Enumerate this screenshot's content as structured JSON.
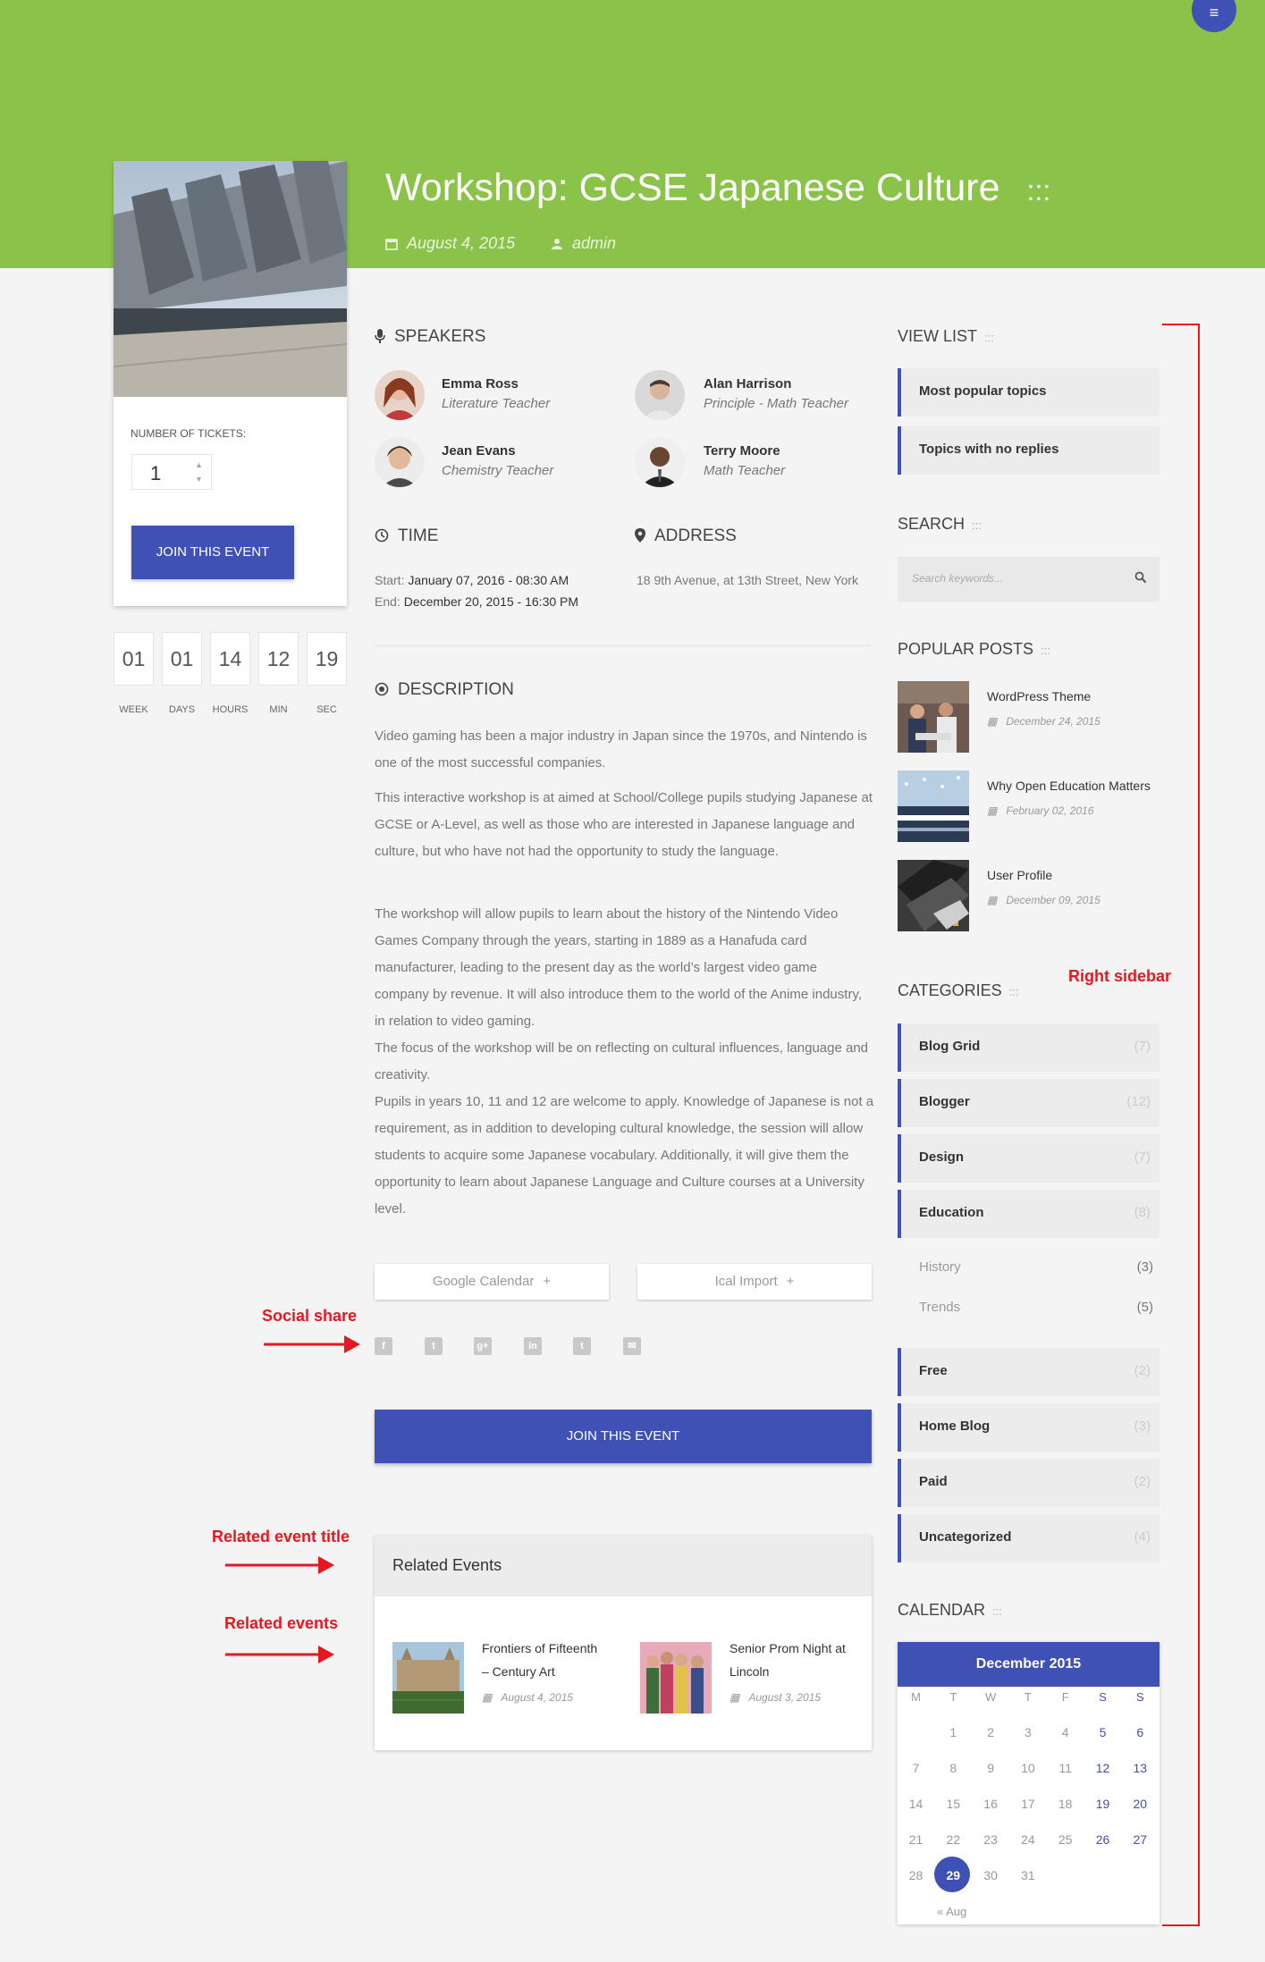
{
  "header": {
    "title": "Workshop: GCSE Japanese Culture",
    "title_dots": ":::",
    "date": "August 4, 2015",
    "author": "admin",
    "menu_icon": "≡"
  },
  "ticket": {
    "label": "NUMBER OF TICKETS:",
    "quantity": "1",
    "join_label": "JOIN THIS EVENT"
  },
  "countdown": [
    {
      "value": "01",
      "label": "WEEK"
    },
    {
      "value": "01",
      "label": "DAYS"
    },
    {
      "value": "14",
      "label": "HOURS"
    },
    {
      "value": "12",
      "label": "MIN"
    },
    {
      "value": "19",
      "label": "SEC"
    }
  ],
  "speakers": {
    "heading": "SPEAKERS",
    "items": [
      {
        "name": "Emma Ross",
        "role": "Literature Teacher"
      },
      {
        "name": "Alan Harrison",
        "role": "Principle - Math Teacher"
      },
      {
        "name": "Jean Evans",
        "role": "Chemistry Teacher"
      },
      {
        "name": "Terry Moore",
        "role": "Math Teacher"
      }
    ]
  },
  "time": {
    "heading": "TIME",
    "start_label": "Start:",
    "start": "January 07, 2016 - 08:30 AM",
    "end_label": "End:",
    "end": "December 20, 2015 - 16:30 PM"
  },
  "address": {
    "heading": "ADDRESS",
    "value": "18 9th Avenue, at 13th Street, New York"
  },
  "description": {
    "heading": "DESCRIPTION",
    "p1": "Video gaming has been a major industry in Japan since the 1970s, and Nintendo is one of the most successful companies.",
    "p2": "This interactive workshop is at aimed at School/College pupils studying Japanese at GCSE or A-Level, as well as those who are interested in Japanese language and culture, but who have not had the opportunity to study the language.",
    "p3": "The workshop will allow pupils to learn about the history of the Nintendo Video Games Company through the years, starting in 1889 as a Hanafuda card manufacturer, leading to the present day as the world’s largest video game company by revenue. It will also introduce them to the world of the Anime industry, in relation to video gaming.",
    "p4": "The focus of the workshop will be on reflecting on cultural influences, language and creativity.",
    "p5": "Pupils in years 10, 11 and 12 are welcome to apply. Knowledge of Japanese is not a requirement, as in addition to developing cultural knowledge, the session will allow students to acquire some Japanese vocabulary. Additionally, it will give them the opportunity to learn about Japanese Language and Culture courses at a University level."
  },
  "actions": {
    "google_calendar": "Google Calendar",
    "ical_import": "Ical Import",
    "join_label": "JOIN THIS EVENT"
  },
  "share_icons": [
    "facebook-icon",
    "twitter-icon",
    "google-plus-icon",
    "linkedin-icon",
    "tumblr-icon",
    "email-icon"
  ],
  "related": {
    "title": "Related Events",
    "items": [
      {
        "name": "Frontiers of Fifteenth – Century Art",
        "date": "August 4, 2015"
      },
      {
        "name": "Senior Prom Night at Lincoln",
        "date": "August 3, 2015"
      }
    ]
  },
  "annotations": {
    "social_share": "Social share",
    "related_title": "Related event title",
    "related_events": "Related events",
    "right_sidebar": "Right sidebar"
  },
  "sidebar": {
    "view_list": {
      "heading": "VIEW LIST",
      "items": [
        "Most popular topics",
        "Topics with no replies"
      ]
    },
    "search": {
      "heading": "SEARCH",
      "placeholder": "Search keywords..."
    },
    "popular_posts": {
      "heading": "POPULAR POSTS",
      "items": [
        {
          "title": "WordPress Theme",
          "date": "December 24, 2015"
        },
        {
          "title": "Why Open Education Matters",
          "date": "February 02, 2016"
        },
        {
          "title": "User Profile",
          "date": "December 09, 2015"
        }
      ]
    },
    "categories": {
      "heading": "CATEGORIES",
      "items": [
        {
          "name": "Blog Grid",
          "count": "(7)"
        },
        {
          "name": "Blogger",
          "count": "(12)"
        },
        {
          "name": "Design",
          "count": "(7)"
        },
        {
          "name": "Education",
          "count": "(8)"
        },
        {
          "name": "Free",
          "count": "(2)"
        },
        {
          "name": "Home Blog",
          "count": "(3)"
        },
        {
          "name": "Paid",
          "count": "(2)"
        },
        {
          "name": "Uncategorized",
          "count": "(4)"
        }
      ],
      "sub_items": [
        {
          "name": "History",
          "count": "(3)"
        },
        {
          "name": "Trends",
          "count": "(5)"
        }
      ]
    },
    "calendar": {
      "heading": "CALENDAR",
      "month": "December 2015",
      "weekdays": [
        "M",
        "T",
        "W",
        "T",
        "F",
        "S",
        "S"
      ],
      "today": "29",
      "prev_link": "« Aug"
    }
  },
  "heading_dots": ":::",
  "colors": {
    "hero": "#8bc34a",
    "primary": "#3f51b5",
    "annotation": "#e8161f"
  }
}
